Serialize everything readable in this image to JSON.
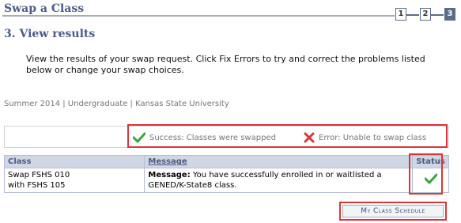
{
  "page": {
    "title": "Swap a Class",
    "step_title": "3.  View results",
    "instructions": "View the results of your swap request.  Click Fix Errors to try and correct the problems listed below or change your swap choices.",
    "term_info": "Summer 2014 | Undergraduate | Kansas State University"
  },
  "steps": [
    "1",
    "2",
    "3"
  ],
  "legend": {
    "success": "Success: Classes were swapped",
    "error": "Error: Unable to swap class"
  },
  "table": {
    "headers": {
      "class": "Class",
      "message": "Message",
      "status": "Status"
    },
    "rows": [
      {
        "class_line1": "Swap FSHS  010",
        "class_line2": "with FSHS  105",
        "message_label": "Message:",
        "message_text": " You have successfully enrolled in or waitlisted a GENED/K-State8 class.",
        "status": "success"
      }
    ]
  },
  "buttons": {
    "my_class_schedule": "My Class Schedule"
  },
  "colors": {
    "success": "#3aa63a",
    "error": "#d9363a",
    "header": "#4b5b8a"
  }
}
